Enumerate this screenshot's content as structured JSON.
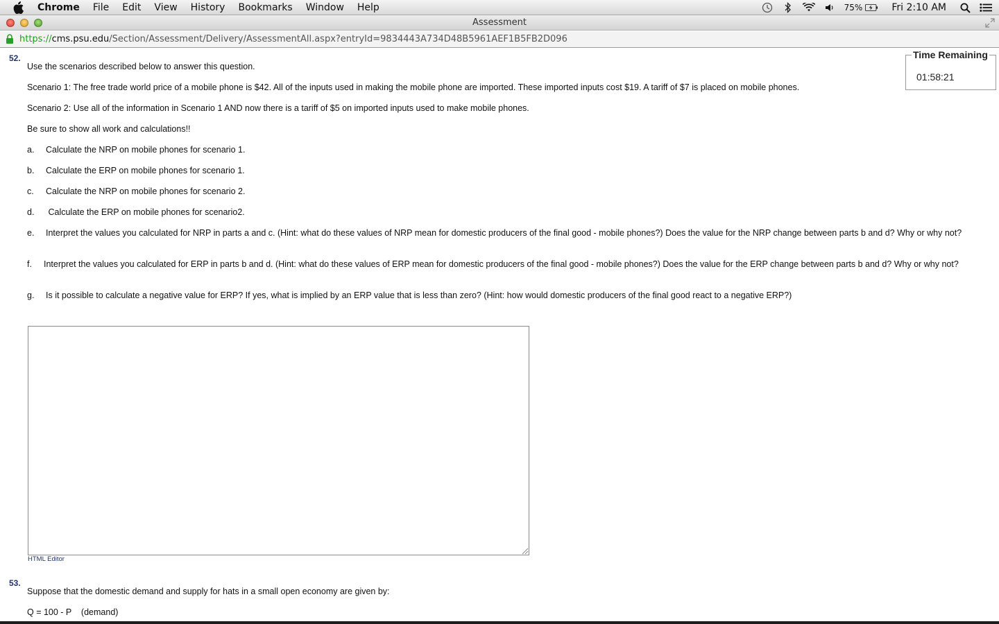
{
  "menubar": {
    "app": "Chrome",
    "items": [
      "File",
      "Edit",
      "View",
      "History",
      "Bookmarks",
      "Window",
      "Help"
    ],
    "battery": "75%",
    "clock": "Fri 2:10 AM"
  },
  "window": {
    "title": "Assessment"
  },
  "url": {
    "scheme": "https://",
    "host": "cms.psu.edu",
    "path": "/Section/Assessment/Delivery/AssessmentAll.aspx?entryId=9834443A734D48B5961AEF1B5FB2D096"
  },
  "timer": {
    "label": "Time Remaining",
    "value": "01:58:21"
  },
  "question52": {
    "number": "52.",
    "intro": "Use the scenarios described below to answer this question.",
    "scenario1": "Scenario 1: The free trade world price of a mobile phone is $42.  All of the inputs used in making the mobile phone are imported.  These imported inputs cost $19.  A tariff of $7 is placed on mobile phones.",
    "scenario2": "Scenario 2: Use all of the information in Scenario 1 AND now there is a tariff of $5 on imported inputs used to make mobile phones.",
    "instruction": "Be sure to show all work and calculations!!",
    "parts": [
      {
        "letter": "a.",
        "text": "Calculate the NRP on mobile phones for scenario 1."
      },
      {
        "letter": "b.",
        "text": "Calculate the ERP on mobile phones for scenario 1."
      },
      {
        "letter": "c.",
        "text": "Calculate the NRP on mobile phones for scenario 2."
      },
      {
        "letter": "d.",
        "text": " Calculate the ERP on mobile phones for scenario2."
      },
      {
        "letter": "e.",
        "text": "Interpret the values you calculated for NRP in parts a and c.  (Hint: what do these values of NRP mean for domestic producers of the final good - mobile phones?) Does the value for the NRP change between parts b and d?  Why or why not?"
      },
      {
        "letter": "f.",
        "text": "Interpret the values you calculated for ERP in parts b and d.  (Hint: what do these values of ERP mean for domestic producers of the final good - mobile phones?) Does the value for the ERP change between parts b and d?  Why or why not?"
      },
      {
        "letter": "g.",
        "text": "Is it possible to calculate a negative value for ERP?  If yes, what is implied by an ERP value that is less than zero? (Hint: how would domestic producers of the final good react to a negative ERP?)"
      }
    ],
    "answer": "",
    "editor_link": "HTML Editor"
  },
  "question53": {
    "number": "53.",
    "intro": "Suppose that the domestic demand and supply for hats in a small open economy are given by:",
    "demand": "Q = 100 - P    (demand)"
  }
}
